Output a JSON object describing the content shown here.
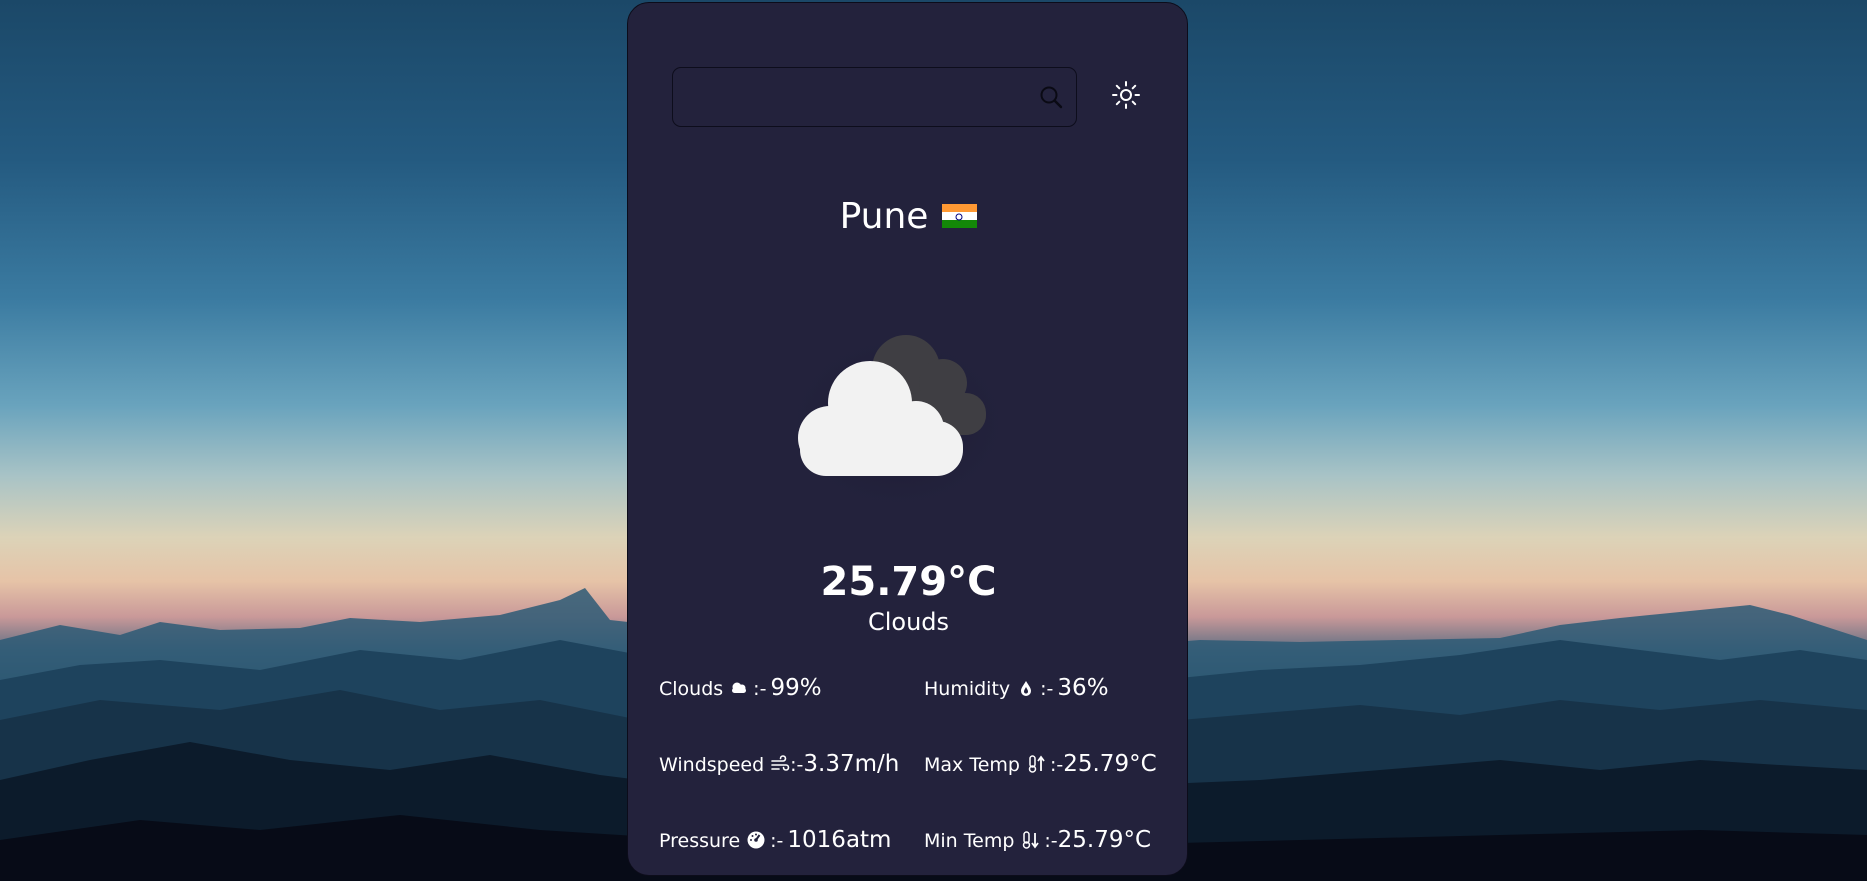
{
  "search": {
    "value": "",
    "placeholder": ""
  },
  "location": {
    "city": "Pune",
    "country_flag": "india-flag-icon"
  },
  "weather": {
    "temperature": "25.79°C",
    "condition": "Clouds",
    "icon": "cloudy-icon"
  },
  "stats": {
    "clouds": {
      "label": "Clouds",
      "separator": ":-",
      "value": "99%",
      "icon": "cloud-icon"
    },
    "humidity": {
      "label": "Humidity",
      "separator": ":-",
      "value": "36%",
      "icon": "droplet-icon"
    },
    "windspeed": {
      "label": "Windspeed",
      "separator": ":-",
      "value": "3.37m/h",
      "icon": "wind-icon"
    },
    "max_temp": {
      "label": "Max Temp",
      "separator": ":-",
      "value": "25.79°C",
      "icon": "thermometer-up-icon"
    },
    "pressure": {
      "label": "Pressure",
      "separator": ":-",
      "value": "1016atm",
      "icon": "gauge-icon"
    },
    "min_temp": {
      "label": "Min Temp",
      "separator": ":-",
      "value": "25.79°C",
      "icon": "thermometer-down-icon"
    }
  },
  "colors": {
    "card_background": "#23223c",
    "text": "#ffffff",
    "flag_saffron": "#ff9933",
    "flag_white": "#ffffff",
    "flag_green": "#138808",
    "flag_chakra": "#000080"
  }
}
